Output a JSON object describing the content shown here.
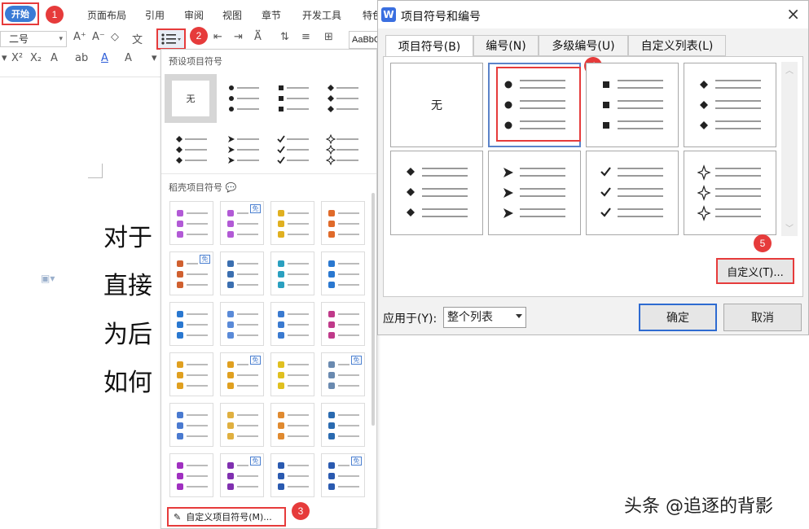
{
  "menubar": {
    "start": "开始",
    "items": [
      "页面布局",
      "引用",
      "审阅",
      "视图",
      "章节",
      "开发工具",
      "特色"
    ]
  },
  "toolbar": {
    "font_size": "二号",
    "style_preview": "AaBbC"
  },
  "document": {
    "lines": [
      "对于",
      "直接",
      "为后",
      "如何"
    ]
  },
  "bullet_panel": {
    "preset_heading": "预设项目符号",
    "preset_none": "无",
    "template_heading": "稻壳项目符号",
    "free_tag": "免",
    "custom_link": "自定义项目符号(M)..."
  },
  "dialog": {
    "title": "项目符号和编号",
    "close": "×",
    "tabs": [
      "项目符号(B)",
      "编号(N)",
      "多级编号(U)",
      "自定义列表(L)"
    ],
    "active_tab": "项目符号(B)",
    "none_option": "无",
    "customize_button": "自定义(T)...",
    "apply_label": "应用于(Y):",
    "apply_value": "整个列表",
    "ok": "确定",
    "cancel": "取消"
  },
  "badges": [
    "1",
    "2",
    "3",
    "4",
    "5"
  ],
  "watermark": "头条 @追逐的背影",
  "colors": {
    "accent_red": "#e63b3b",
    "accent_blue": "#3a7bd5"
  }
}
